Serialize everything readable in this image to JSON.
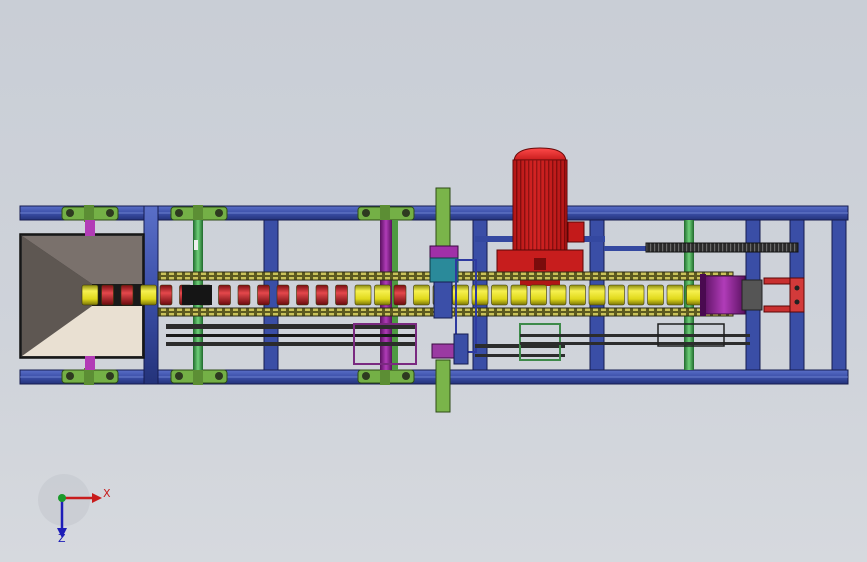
{
  "axes": {
    "x_label": "X",
    "z_label": "Z"
  },
  "colors": {
    "background": "#cdd2d9",
    "frame": "#3b4fa8",
    "frame_dark": "#1d2a6e",
    "motor_red": "#d81e1e",
    "roller_yellow": "#e8e21a",
    "roller_red": "#d8343a",
    "bearing_green": "#7fb84a",
    "purple": "#8a2a8c",
    "shaft_green": "#3e9a4e",
    "hopper_grey": "#7c736e",
    "hopper_light": "#e6ddd0"
  }
}
